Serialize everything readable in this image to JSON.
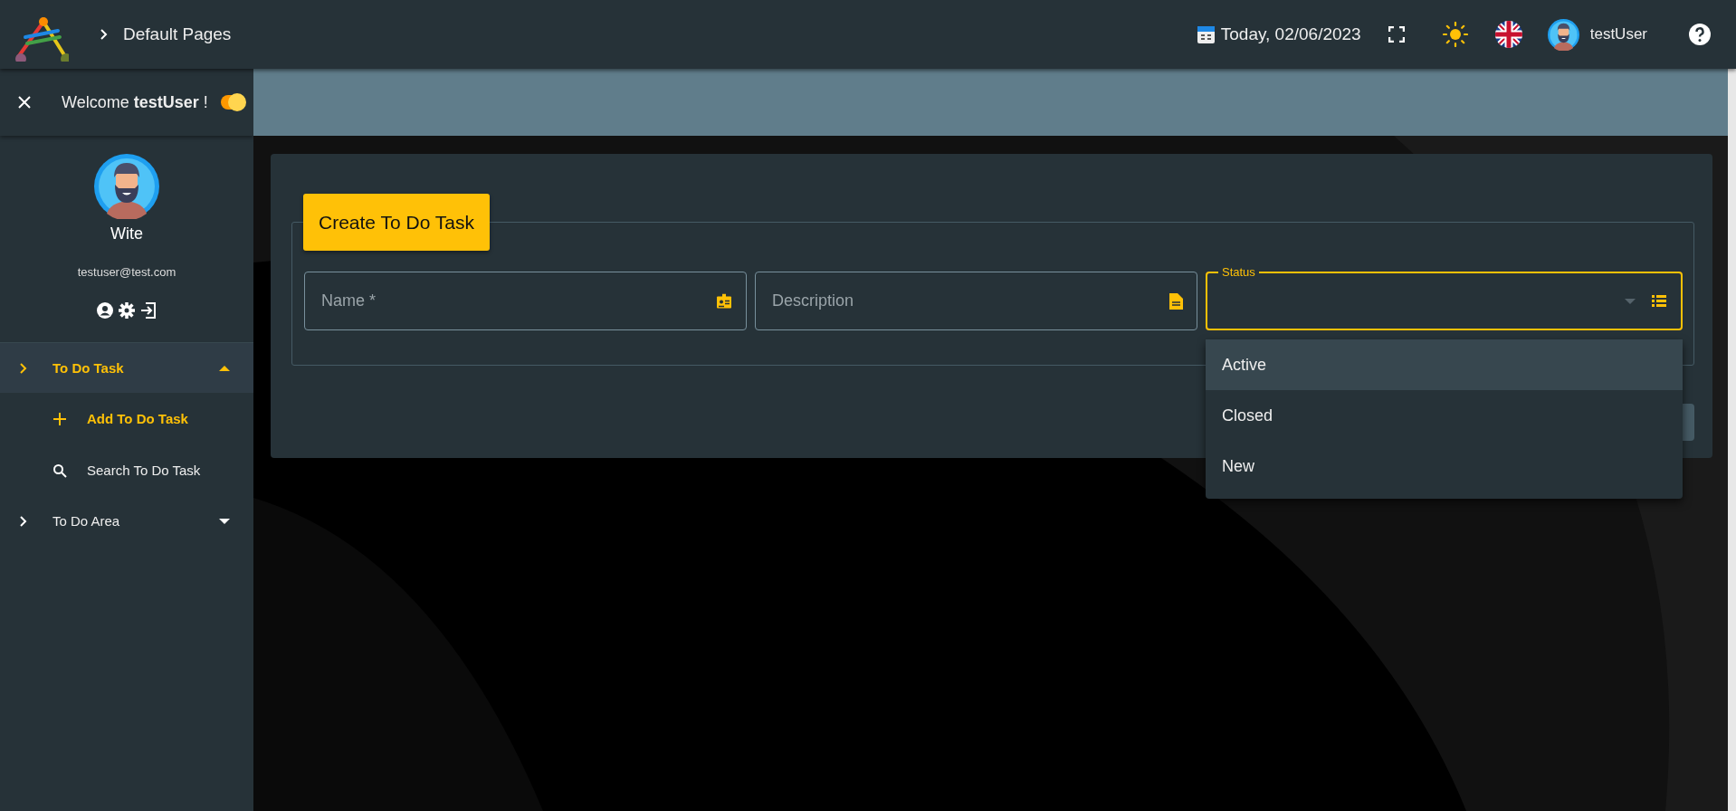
{
  "topbar": {
    "breadcrumb": "Default Pages",
    "date": "Today, 02/06/2023",
    "user": "testUser"
  },
  "sidebar": {
    "welcome": "Welcome **testUser** !",
    "dark_mode_on": true,
    "name": "Wite",
    "email": "testuser@test.com",
    "menu": [
      {
        "label": "To Do Task",
        "expanded": true,
        "selected": true,
        "children": [
          {
            "label": "Add To Do Task",
            "kind": "add",
            "selected": true
          },
          {
            "label": "Search To Do Task",
            "kind": "search",
            "selected": false
          }
        ]
      },
      {
        "label": "To Do Area",
        "expanded": false,
        "selected": false
      }
    ]
  },
  "form": {
    "title": "Create To Do Task",
    "fields": [
      {
        "kind": "text",
        "placeholder": "Name *"
      },
      {
        "kind": "text",
        "placeholder": "Description"
      },
      {
        "kind": "select",
        "label": "Status",
        "focused": true,
        "open": true,
        "options": [
          {
            "label": "Active",
            "highlighted": true
          },
          {
            "label": "Closed",
            "highlighted": false
          },
          {
            "label": "New",
            "highlighted": false
          }
        ]
      }
    ]
  }
}
